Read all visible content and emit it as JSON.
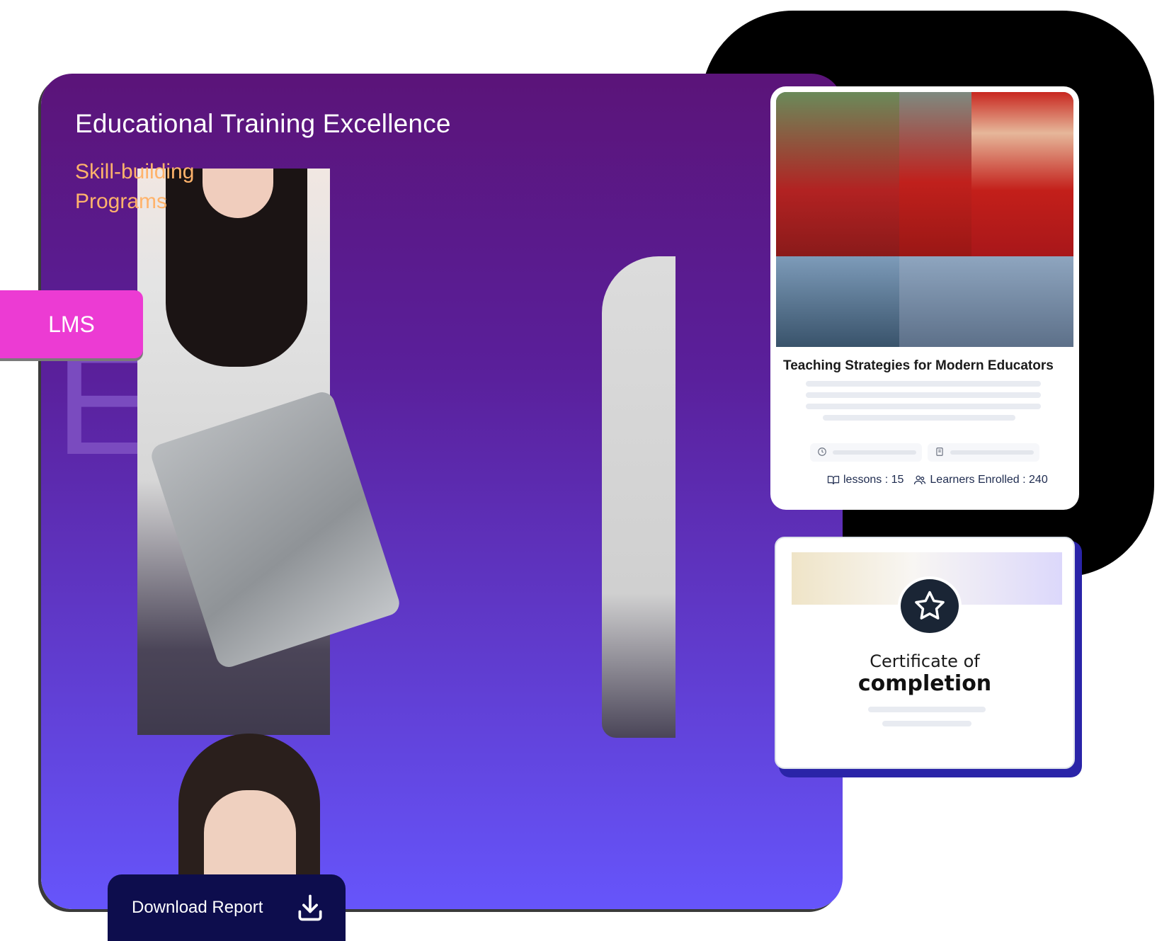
{
  "panel": {
    "title": "Educational Training Excellence",
    "subtitle": "Skill-building Programs",
    "watermark_letter": "E"
  },
  "tag": {
    "label": "LMS"
  },
  "download": {
    "label": "Download Report",
    "icon": "download-icon"
  },
  "course_card": {
    "title": "Teaching Strategies for Modern Educators",
    "meta_icons": [
      "clock-icon",
      "certificate-icon"
    ],
    "stats": {
      "lessons_label": "lessons : 15",
      "learners_label": "Learners Enrolled : 240",
      "lessons_icon": "book-open-icon",
      "learners_icon": "users-icon"
    }
  },
  "certificate": {
    "line1": "Certificate of",
    "line2": "completion",
    "badge_icon": "star-icon"
  },
  "colors": {
    "panel_top": "#5b1479",
    "panel_bottom": "#6655fb",
    "subtitle": "#ffb36b",
    "tag_bg": "#ec3bd3",
    "button_bg": "#0d0d4d",
    "badge_bg": "#1a2535"
  }
}
